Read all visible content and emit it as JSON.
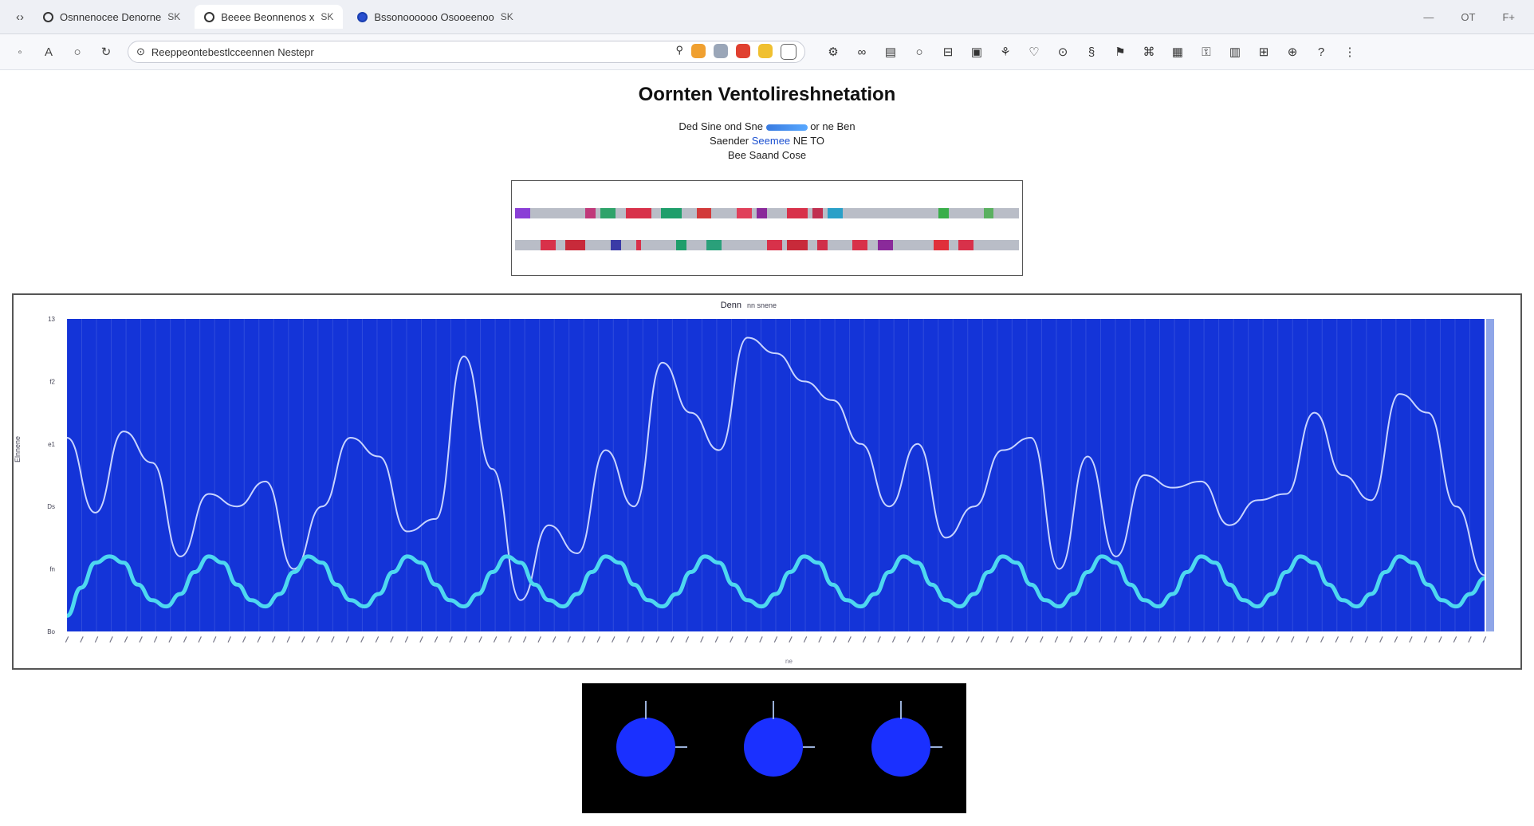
{
  "browser": {
    "tabs": [
      {
        "label": "Osnnenocee Denorne",
        "status": "SK",
        "active": false
      },
      {
        "label": "Beeee Beonnenos x",
        "status": "SK",
        "active": true
      },
      {
        "label": "Bssonoooooo Osooeenoo",
        "status": "SK",
        "active": false
      }
    ],
    "url": "Reeppeontebestlcceennen Nestepr",
    "window_controls": [
      "—",
      "OT",
      "F+"
    ]
  },
  "page": {
    "title": "Oornten Ventolireshnetation",
    "info_line1_pre": "Ded Sine ond Sne",
    "info_line1_post": "or ne Ben",
    "info_line2_label": "Saender",
    "info_line2_value": "Seemee",
    "info_line2_post": "NE TO",
    "info_line3": "Bee Saand Cose"
  },
  "sequence_tracks": [
    [
      {
        "start": 0.0,
        "end": 0.03,
        "color": "#8a3fd6"
      },
      {
        "start": 0.14,
        "end": 0.16,
        "color": "#c0397a"
      },
      {
        "start": 0.17,
        "end": 0.2,
        "color": "#2fa36a"
      },
      {
        "start": 0.22,
        "end": 0.27,
        "color": "#d8314a"
      },
      {
        "start": 0.29,
        "end": 0.33,
        "color": "#1f9e6b"
      },
      {
        "start": 0.36,
        "end": 0.39,
        "color": "#d23a3a"
      },
      {
        "start": 0.44,
        "end": 0.47,
        "color": "#e0405a"
      },
      {
        "start": 0.48,
        "end": 0.5,
        "color": "#8a2a9a"
      },
      {
        "start": 0.54,
        "end": 0.58,
        "color": "#d8314a"
      },
      {
        "start": 0.59,
        "end": 0.61,
        "color": "#c03050"
      },
      {
        "start": 0.62,
        "end": 0.65,
        "color": "#2aa0c8"
      },
      {
        "start": 0.84,
        "end": 0.86,
        "color": "#3aae4a"
      },
      {
        "start": 0.93,
        "end": 0.95,
        "color": "#5ab060"
      }
    ],
    [
      {
        "start": 0.05,
        "end": 0.08,
        "color": "#d8314a"
      },
      {
        "start": 0.1,
        "end": 0.14,
        "color": "#c82a3a"
      },
      {
        "start": 0.19,
        "end": 0.21,
        "color": "#3a3aa6"
      },
      {
        "start": 0.24,
        "end": 0.25,
        "color": "#d8314a"
      },
      {
        "start": 0.32,
        "end": 0.34,
        "color": "#1f9e6b"
      },
      {
        "start": 0.38,
        "end": 0.41,
        "color": "#2aa07a"
      },
      {
        "start": 0.5,
        "end": 0.53,
        "color": "#d8314a"
      },
      {
        "start": 0.54,
        "end": 0.58,
        "color": "#c82a3a"
      },
      {
        "start": 0.6,
        "end": 0.62,
        "color": "#d0304a"
      },
      {
        "start": 0.67,
        "end": 0.7,
        "color": "#d8314a"
      },
      {
        "start": 0.72,
        "end": 0.75,
        "color": "#8a2a9a"
      },
      {
        "start": 0.83,
        "end": 0.86,
        "color": "#e0303a"
      },
      {
        "start": 0.88,
        "end": 0.91,
        "color": "#d8314a"
      }
    ]
  ],
  "chart_data": {
    "type": "line",
    "title": "Denn",
    "subtitle": "nn snene",
    "xlabel": "ne",
    "ylabel": "Elnnene",
    "y_ticks": [
      "Bo",
      "fn",
      "Ds",
      "e1",
      "f2",
      "13"
    ],
    "xlim": [
      0,
      100
    ],
    "ylim": [
      0,
      100
    ],
    "grid": true,
    "legend": "none",
    "background": "#1434d8",
    "series": [
      {
        "color": "#c8d4ff",
        "x": [
          0,
          2,
          4,
          6,
          8,
          10,
          12,
          14,
          16,
          18,
          20,
          22,
          24,
          26,
          28,
          30,
          32,
          34,
          36,
          38,
          40,
          42,
          44,
          46,
          48,
          50,
          52,
          54,
          56,
          58,
          60,
          62,
          64,
          66,
          68,
          70,
          72,
          74,
          76,
          78,
          80,
          82,
          84,
          86,
          88,
          90,
          92,
          94,
          96,
          98,
          100
        ],
        "y": [
          62,
          38,
          64,
          54,
          24,
          44,
          40,
          48,
          20,
          40,
          62,
          56,
          32,
          36,
          88,
          52,
          10,
          34,
          25,
          58,
          40,
          86,
          70,
          58,
          94,
          89,
          80,
          74,
          60,
          40,
          60,
          30,
          40,
          58,
          62,
          20,
          56,
          24,
          50,
          46,
          48,
          34,
          42,
          44,
          70,
          50,
          42,
          76,
          70,
          40,
          18
        ]
      },
      {
        "color": "#4ed8f0",
        "x": [
          0,
          1,
          2,
          3,
          4,
          5,
          6,
          7,
          8,
          9,
          10,
          11,
          12,
          13,
          14,
          15,
          16,
          17,
          18,
          19,
          20,
          21,
          22,
          23,
          24,
          25,
          26,
          27,
          28,
          29,
          30,
          31,
          32,
          33,
          34,
          35,
          36,
          37,
          38,
          39,
          40,
          41,
          42,
          43,
          44,
          45,
          46,
          47,
          48,
          49,
          50,
          51,
          52,
          53,
          54,
          55,
          56,
          57,
          58,
          59,
          60,
          61,
          62,
          63,
          64,
          65,
          66,
          67,
          68,
          69,
          70,
          71,
          72,
          73,
          74,
          75,
          76,
          77,
          78,
          79,
          80,
          81,
          82,
          83,
          84,
          85,
          86,
          87,
          88,
          89,
          90,
          91,
          92,
          93,
          94,
          95,
          96,
          97,
          98,
          99,
          100
        ],
        "y": [
          5,
          14,
          22,
          24,
          22,
          15,
          10,
          8,
          12,
          19,
          24,
          22,
          15,
          10,
          8,
          12,
          19,
          24,
          22,
          15,
          10,
          8,
          12,
          19,
          24,
          22,
          15,
          10,
          8,
          12,
          19,
          24,
          22,
          15,
          10,
          8,
          12,
          19,
          24,
          22,
          15,
          10,
          8,
          12,
          19,
          24,
          22,
          15,
          10,
          8,
          12,
          19,
          24,
          22,
          15,
          10,
          8,
          12,
          19,
          24,
          22,
          15,
          10,
          8,
          12,
          19,
          24,
          22,
          15,
          10,
          8,
          12,
          19,
          24,
          22,
          15,
          10,
          8,
          12,
          19,
          24,
          22,
          15,
          10,
          8,
          12,
          19,
          24,
          22,
          15,
          10,
          8,
          12,
          19,
          24,
          22,
          15,
          10,
          8,
          12,
          17
        ]
      }
    ]
  },
  "orbs": {
    "count": 3,
    "color": "#1a30ff"
  }
}
